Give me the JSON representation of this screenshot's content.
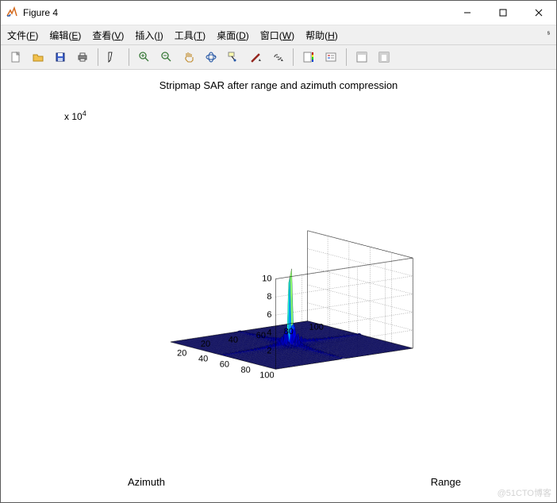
{
  "window": {
    "title": "Figure 4"
  },
  "menubar": {
    "items": [
      {
        "label": "文件",
        "mn": "F"
      },
      {
        "label": "编辑",
        "mn": "E"
      },
      {
        "label": "查看",
        "mn": "V"
      },
      {
        "label": "插入",
        "mn": "I"
      },
      {
        "label": "工具",
        "mn": "T"
      },
      {
        "label": "桌面",
        "mn": "D"
      },
      {
        "label": "窗口",
        "mn": "W"
      },
      {
        "label": "帮助",
        "mn": "H"
      }
    ]
  },
  "toolbar": {
    "new": "New Figure",
    "open": "Open",
    "save": "Save",
    "print": "Print",
    "edit": "Edit Plot",
    "zoomin": "Zoom In",
    "zoomout": "Zoom Out",
    "pan": "Pan",
    "rotate3d": "Rotate 3D",
    "datacursor": "Data Cursor",
    "brush": "Brush",
    "link": "Link Plot",
    "colorbar": "Insert Colorbar",
    "legend": "Insert Legend",
    "hideplot": "Hide Plot Tools",
    "showplot": "Show Plot Tools"
  },
  "chart_data": {
    "type": "surf3d",
    "title": "Stripmap SAR after range and azimuth compression",
    "xlabel": "Range",
    "ylabel": "Azimuth",
    "zlabel": "",
    "z_exponent_label": "x 10^4",
    "xticks": [
      20,
      40,
      60,
      80,
      100
    ],
    "yticks": [
      20,
      40,
      60,
      80,
      100
    ],
    "zticks": [
      2,
      4,
      6,
      8,
      10
    ],
    "xlim": [
      1,
      100
    ],
    "ylim": [
      1,
      100
    ],
    "zlim": [
      0,
      10
    ],
    "zscale": 10000,
    "peak": {
      "range": 50,
      "azimuth": 50,
      "value_scaled": 10
    },
    "description": "2-D sinc-shaped point spread function on a 100x100 grid. Central peak at (Range≈50, Azimuth≈50) reaching ≈10×10^4 amplitude. Low sidelobe ridges extend along both Range and Azimuth axes through the peak."
  },
  "watermark": "@51CTO博客"
}
